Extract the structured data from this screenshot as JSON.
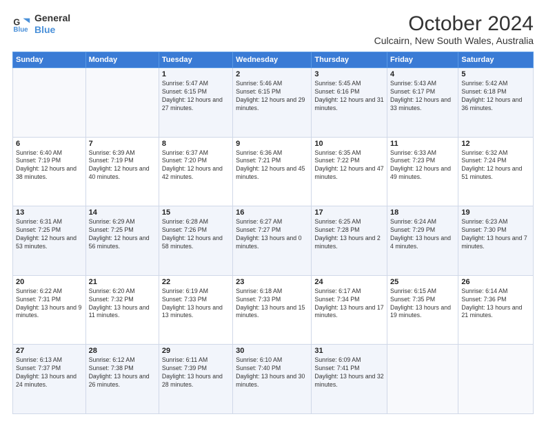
{
  "logo": {
    "line1": "General",
    "line2": "Blue",
    "icon": "🔵"
  },
  "title": "October 2024",
  "subtitle": "Culcairn, New South Wales, Australia",
  "days_of_week": [
    "Sunday",
    "Monday",
    "Tuesday",
    "Wednesday",
    "Thursday",
    "Friday",
    "Saturday"
  ],
  "weeks": [
    [
      {
        "day": "",
        "sunrise": "",
        "sunset": "",
        "daylight": ""
      },
      {
        "day": "",
        "sunrise": "",
        "sunset": "",
        "daylight": ""
      },
      {
        "day": "1",
        "sunrise": "Sunrise: 5:47 AM",
        "sunset": "Sunset: 6:15 PM",
        "daylight": "Daylight: 12 hours and 27 minutes."
      },
      {
        "day": "2",
        "sunrise": "Sunrise: 5:46 AM",
        "sunset": "Sunset: 6:15 PM",
        "daylight": "Daylight: 12 hours and 29 minutes."
      },
      {
        "day": "3",
        "sunrise": "Sunrise: 5:45 AM",
        "sunset": "Sunset: 6:16 PM",
        "daylight": "Daylight: 12 hours and 31 minutes."
      },
      {
        "day": "4",
        "sunrise": "Sunrise: 5:43 AM",
        "sunset": "Sunset: 6:17 PM",
        "daylight": "Daylight: 12 hours and 33 minutes."
      },
      {
        "day": "5",
        "sunrise": "Sunrise: 5:42 AM",
        "sunset": "Sunset: 6:18 PM",
        "daylight": "Daylight: 12 hours and 36 minutes."
      }
    ],
    [
      {
        "day": "6",
        "sunrise": "Sunrise: 6:40 AM",
        "sunset": "Sunset: 7:19 PM",
        "daylight": "Daylight: 12 hours and 38 minutes."
      },
      {
        "day": "7",
        "sunrise": "Sunrise: 6:39 AM",
        "sunset": "Sunset: 7:19 PM",
        "daylight": "Daylight: 12 hours and 40 minutes."
      },
      {
        "day": "8",
        "sunrise": "Sunrise: 6:37 AM",
        "sunset": "Sunset: 7:20 PM",
        "daylight": "Daylight: 12 hours and 42 minutes."
      },
      {
        "day": "9",
        "sunrise": "Sunrise: 6:36 AM",
        "sunset": "Sunset: 7:21 PM",
        "daylight": "Daylight: 12 hours and 45 minutes."
      },
      {
        "day": "10",
        "sunrise": "Sunrise: 6:35 AM",
        "sunset": "Sunset: 7:22 PM",
        "daylight": "Daylight: 12 hours and 47 minutes."
      },
      {
        "day": "11",
        "sunrise": "Sunrise: 6:33 AM",
        "sunset": "Sunset: 7:23 PM",
        "daylight": "Daylight: 12 hours and 49 minutes."
      },
      {
        "day": "12",
        "sunrise": "Sunrise: 6:32 AM",
        "sunset": "Sunset: 7:24 PM",
        "daylight": "Daylight: 12 hours and 51 minutes."
      }
    ],
    [
      {
        "day": "13",
        "sunrise": "Sunrise: 6:31 AM",
        "sunset": "Sunset: 7:25 PM",
        "daylight": "Daylight: 12 hours and 53 minutes."
      },
      {
        "day": "14",
        "sunrise": "Sunrise: 6:29 AM",
        "sunset": "Sunset: 7:25 PM",
        "daylight": "Daylight: 12 hours and 56 minutes."
      },
      {
        "day": "15",
        "sunrise": "Sunrise: 6:28 AM",
        "sunset": "Sunset: 7:26 PM",
        "daylight": "Daylight: 12 hours and 58 minutes."
      },
      {
        "day": "16",
        "sunrise": "Sunrise: 6:27 AM",
        "sunset": "Sunset: 7:27 PM",
        "daylight": "Daylight: 13 hours and 0 minutes."
      },
      {
        "day": "17",
        "sunrise": "Sunrise: 6:25 AM",
        "sunset": "Sunset: 7:28 PM",
        "daylight": "Daylight: 13 hours and 2 minutes."
      },
      {
        "day": "18",
        "sunrise": "Sunrise: 6:24 AM",
        "sunset": "Sunset: 7:29 PM",
        "daylight": "Daylight: 13 hours and 4 minutes."
      },
      {
        "day": "19",
        "sunrise": "Sunrise: 6:23 AM",
        "sunset": "Sunset: 7:30 PM",
        "daylight": "Daylight: 13 hours and 7 minutes."
      }
    ],
    [
      {
        "day": "20",
        "sunrise": "Sunrise: 6:22 AM",
        "sunset": "Sunset: 7:31 PM",
        "daylight": "Daylight: 13 hours and 9 minutes."
      },
      {
        "day": "21",
        "sunrise": "Sunrise: 6:20 AM",
        "sunset": "Sunset: 7:32 PM",
        "daylight": "Daylight: 13 hours and 11 minutes."
      },
      {
        "day": "22",
        "sunrise": "Sunrise: 6:19 AM",
        "sunset": "Sunset: 7:33 PM",
        "daylight": "Daylight: 13 hours and 13 minutes."
      },
      {
        "day": "23",
        "sunrise": "Sunrise: 6:18 AM",
        "sunset": "Sunset: 7:33 PM",
        "daylight": "Daylight: 13 hours and 15 minutes."
      },
      {
        "day": "24",
        "sunrise": "Sunrise: 6:17 AM",
        "sunset": "Sunset: 7:34 PM",
        "daylight": "Daylight: 13 hours and 17 minutes."
      },
      {
        "day": "25",
        "sunrise": "Sunrise: 6:15 AM",
        "sunset": "Sunset: 7:35 PM",
        "daylight": "Daylight: 13 hours and 19 minutes."
      },
      {
        "day": "26",
        "sunrise": "Sunrise: 6:14 AM",
        "sunset": "Sunset: 7:36 PM",
        "daylight": "Daylight: 13 hours and 21 minutes."
      }
    ],
    [
      {
        "day": "27",
        "sunrise": "Sunrise: 6:13 AM",
        "sunset": "Sunset: 7:37 PM",
        "daylight": "Daylight: 13 hours and 24 minutes."
      },
      {
        "day": "28",
        "sunrise": "Sunrise: 6:12 AM",
        "sunset": "Sunset: 7:38 PM",
        "daylight": "Daylight: 13 hours and 26 minutes."
      },
      {
        "day": "29",
        "sunrise": "Sunrise: 6:11 AM",
        "sunset": "Sunset: 7:39 PM",
        "daylight": "Daylight: 13 hours and 28 minutes."
      },
      {
        "day": "30",
        "sunrise": "Sunrise: 6:10 AM",
        "sunset": "Sunset: 7:40 PM",
        "daylight": "Daylight: 13 hours and 30 minutes."
      },
      {
        "day": "31",
        "sunrise": "Sunrise: 6:09 AM",
        "sunset": "Sunset: 7:41 PM",
        "daylight": "Daylight: 13 hours and 32 minutes."
      },
      {
        "day": "",
        "sunrise": "",
        "sunset": "",
        "daylight": ""
      },
      {
        "day": "",
        "sunrise": "",
        "sunset": "",
        "daylight": ""
      }
    ]
  ]
}
